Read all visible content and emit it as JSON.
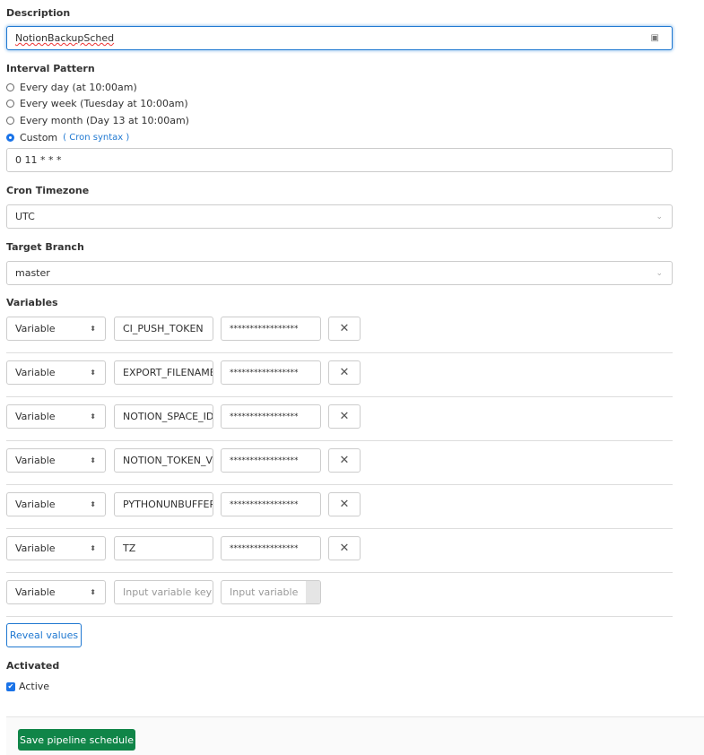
{
  "description": {
    "label": "Description",
    "value": "NotionBackupSched"
  },
  "interval": {
    "label": "Interval Pattern",
    "options": [
      {
        "label": "Every day (at 10:00am)",
        "checked": false
      },
      {
        "label": "Every week (Tuesday at 10:00am)",
        "checked": false
      },
      {
        "label": "Every month (Day 13 at 10:00am)",
        "checked": false
      },
      {
        "label": "Custom",
        "checked": true
      }
    ],
    "cron_link_open": "(",
    "cron_link": "Cron syntax",
    "cron_link_close": ")",
    "cron_value": "0 11 * * *"
  },
  "timezone": {
    "label": "Cron Timezone",
    "value": "UTC"
  },
  "branch": {
    "label": "Target Branch",
    "value": "master"
  },
  "variables": {
    "label": "Variables",
    "rows": [
      {
        "type": "Variable",
        "key": "CI_PUSH_TOKEN",
        "value": "*****************"
      },
      {
        "type": "Variable",
        "key": "EXPORT_FILENAME",
        "value": "*****************"
      },
      {
        "type": "Variable",
        "key": "NOTION_SPACE_ID",
        "value": "*****************"
      },
      {
        "type": "Variable",
        "key": "NOTION_TOKEN_V",
        "value": "*****************"
      },
      {
        "type": "Variable",
        "key": "PYTHONUNBUFFER",
        "value": "*****************"
      },
      {
        "type": "Variable",
        "key": "TZ",
        "value": "*****************"
      }
    ],
    "new_row": {
      "type": "Variable",
      "key_placeholder": "Input variable key",
      "value_placeholder": "Input variable"
    },
    "reveal_label": "Reveal values"
  },
  "activated": {
    "label": "Activated",
    "checkbox_label": "Active",
    "checked": true
  },
  "save_label": "Save pipeline schedule",
  "colors": {
    "accent": "#1f78d1",
    "save": "#108548"
  }
}
